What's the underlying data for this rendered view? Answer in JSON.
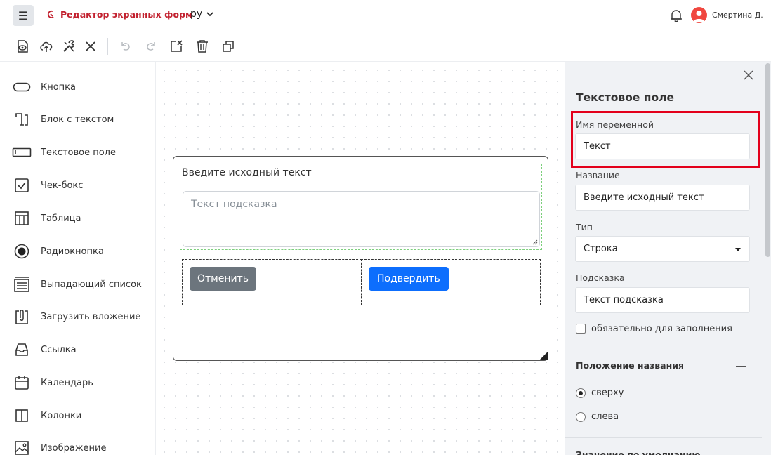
{
  "header": {
    "menu_icon": "☰",
    "app_title": "Редактор экранных форм",
    "language": "ру",
    "user_name": "Смертина Д."
  },
  "toolbar": {
    "icons": [
      "preview-icon",
      "cloud-upload-icon",
      "tools-icon",
      "close-icon",
      "undo-icon",
      "redo-icon",
      "clear-icon",
      "trash-icon",
      "duplicate-icon"
    ]
  },
  "palette": {
    "items": [
      {
        "label": "Кнопка",
        "icon": "button-icon"
      },
      {
        "label": "Блок с текстом",
        "icon": "text-block-icon"
      },
      {
        "label": "Текстовое поле",
        "icon": "text-field-icon"
      },
      {
        "label": "Чек-бокс",
        "icon": "checkbox-icon"
      },
      {
        "label": "Таблица",
        "icon": "table-icon"
      },
      {
        "label": "Радиокнопка",
        "icon": "radio-icon"
      },
      {
        "label": "Выпадающий список",
        "icon": "dropdown-icon"
      },
      {
        "label": "Загрузить вложение",
        "icon": "attachment-icon"
      },
      {
        "label": "Ссылка",
        "icon": "link-icon"
      },
      {
        "label": "Календарь",
        "icon": "calendar-icon"
      },
      {
        "label": "Колонки",
        "icon": "columns-icon"
      },
      {
        "label": "Изображение",
        "icon": "image-icon"
      }
    ]
  },
  "canvas": {
    "field_label": "Введите исходный текст",
    "field_placeholder": "Текст подсказка",
    "cancel_label": "Отменить",
    "confirm_label": "Подвердить"
  },
  "properties": {
    "title": "Текстовое поле",
    "variable_name_label": "Имя переменной",
    "variable_name_value": "Текст",
    "name_label": "Название",
    "name_value": "Введите исходный текст",
    "type_label": "Тип",
    "type_value": "Строка",
    "hint_label": "Подсказка",
    "hint_value": "Текст подсказка",
    "required_label": "обязательно для заполнения",
    "required_checked": false,
    "label_position_title": "Положение названия",
    "position_top": "сверху",
    "position_left": "слева",
    "position_selected": "сверху",
    "default_value_title": "Значение по умолчанию",
    "highlight_color": "#e3001b"
  }
}
